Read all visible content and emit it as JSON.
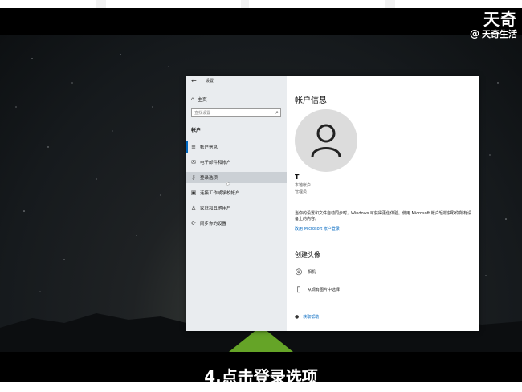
{
  "watermark": {
    "main": "天奇",
    "sub_symbol": "@",
    "sub": "天奇生活"
  },
  "caption": "4.点击登录选项",
  "window": {
    "title": "设置",
    "back_icon": "←",
    "controls": {
      "minimize": "—",
      "maximize": "□",
      "close": "✕"
    }
  },
  "sidebar": {
    "home": "主页",
    "search_placeholder": "查找设置",
    "section": "帐户",
    "items": [
      {
        "label": "帐户信息",
        "icon": "≡"
      },
      {
        "label": "电子邮件和帐户",
        "icon": "✉"
      },
      {
        "label": "登录选项",
        "icon": "🔍"
      },
      {
        "label": "连接工作或学校帐户",
        "icon": "▣"
      },
      {
        "label": "家庭和其他用户",
        "icon": "♙"
      },
      {
        "label": "同步你的设置",
        "icon": "⟳"
      }
    ]
  },
  "content": {
    "title": "帐户信息",
    "username": "T",
    "account_type": "本地帐户",
    "role": "管理员",
    "description": "当你的设置和文件自动同步时，Windows 可获得更佳体验。使用 Microsoft 帐户轻松获取你所有设备上的内容。",
    "link": "改用 Microsoft 帐户登录",
    "create_avatar": "创建头像",
    "options": [
      {
        "label": "相机",
        "icon": "camera-icon"
      },
      {
        "label": "从现有图片中选择",
        "icon": "browse-icon"
      }
    ],
    "help": "获取帮助"
  }
}
